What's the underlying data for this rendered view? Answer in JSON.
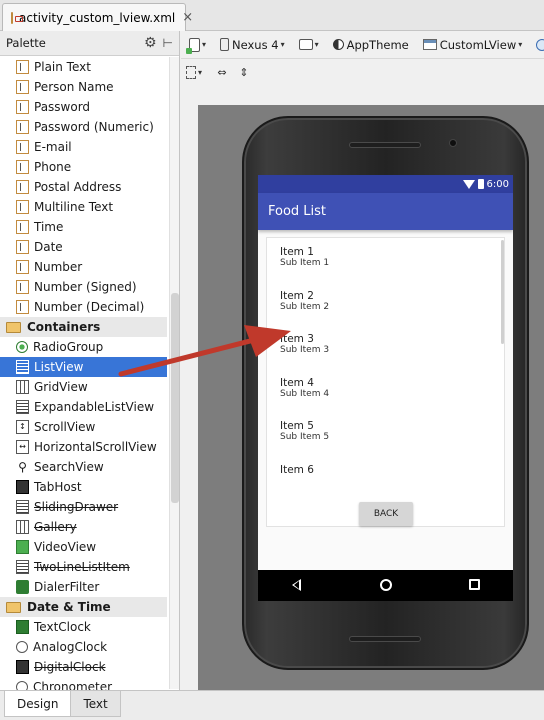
{
  "editor_tab": {
    "title": "activity_custom_lview.xml",
    "close": "×"
  },
  "palette": {
    "title": "Palette",
    "rows": [
      {
        "type": "item",
        "label": "Plain Text",
        "icon": "text-field-icon"
      },
      {
        "type": "item",
        "label": "Person Name",
        "icon": "text-field-icon"
      },
      {
        "type": "item",
        "label": "Password",
        "icon": "text-field-icon"
      },
      {
        "type": "item",
        "label": "Password (Numeric)",
        "icon": "text-field-icon"
      },
      {
        "type": "item",
        "label": "E-mail",
        "icon": "text-field-icon"
      },
      {
        "type": "item",
        "label": "Phone",
        "icon": "text-field-icon"
      },
      {
        "type": "item",
        "label": "Postal Address",
        "icon": "text-field-icon"
      },
      {
        "type": "item",
        "label": "Multiline Text",
        "icon": "text-field-icon"
      },
      {
        "type": "item",
        "label": "Time",
        "icon": "text-field-icon"
      },
      {
        "type": "item",
        "label": "Date",
        "icon": "text-field-icon"
      },
      {
        "type": "item",
        "label": "Number",
        "icon": "text-field-icon"
      },
      {
        "type": "item",
        "label": "Number (Signed)",
        "icon": "text-field-icon"
      },
      {
        "type": "item",
        "label": "Number (Decimal)",
        "icon": "text-field-icon"
      },
      {
        "type": "category",
        "label": "Containers",
        "icon": "folder-icon"
      },
      {
        "type": "item",
        "label": "RadioGroup",
        "icon": "radio-group-icon"
      },
      {
        "type": "item",
        "label": "ListView",
        "icon": "list-view-icon",
        "selected": true
      },
      {
        "type": "item",
        "label": "GridView",
        "icon": "grid-view-icon"
      },
      {
        "type": "item",
        "label": "ExpandableListView",
        "icon": "expandable-list-icon"
      },
      {
        "type": "item",
        "label": "ScrollView",
        "icon": "scroll-view-icon"
      },
      {
        "type": "item",
        "label": "HorizontalScrollView",
        "icon": "horizontal-scroll-icon"
      },
      {
        "type": "item",
        "label": "SearchView",
        "icon": "search-icon"
      },
      {
        "type": "item",
        "label": "TabHost",
        "icon": "tab-host-icon"
      },
      {
        "type": "item",
        "label": "SlidingDrawer",
        "icon": "sliding-drawer-icon",
        "deprecated": true
      },
      {
        "type": "item",
        "label": "Gallery",
        "icon": "gallery-icon",
        "deprecated": true
      },
      {
        "type": "item",
        "label": "VideoView",
        "icon": "video-view-icon"
      },
      {
        "type": "item",
        "label": "TwoLineListItem",
        "icon": "two-line-list-icon",
        "deprecated": true
      },
      {
        "type": "item",
        "label": "DialerFilter",
        "icon": "dialer-filter-icon"
      },
      {
        "type": "category",
        "label": "Date & Time",
        "icon": "folder-icon"
      },
      {
        "type": "item",
        "label": "TextClock",
        "icon": "text-clock-icon"
      },
      {
        "type": "item",
        "label": "AnalogClock",
        "icon": "analog-clock-icon"
      },
      {
        "type": "item",
        "label": "DigitalClock",
        "icon": "digital-clock-icon",
        "deprecated": true
      },
      {
        "type": "item",
        "label": "Chronometer",
        "icon": "chronometer-icon"
      }
    ]
  },
  "toolbar": {
    "device": "Nexus 4",
    "theme": "AppTheme",
    "activity": "CustomLView",
    "caret": "▾"
  },
  "preview": {
    "status_time": "6:00",
    "app_title": "Food List",
    "list_items": [
      {
        "title": "Item 1",
        "sub": "Sub Item 1"
      },
      {
        "title": "Item 2",
        "sub": "Sub Item 2"
      },
      {
        "title": "Item 3",
        "sub": "Sub Item 3"
      },
      {
        "title": "Item 4",
        "sub": "Sub Item 4"
      },
      {
        "title": "Item 5",
        "sub": "Sub Item 5"
      },
      {
        "title": "Item 6",
        "sub": ""
      }
    ],
    "back_label": "BACK"
  },
  "bottom_tabs": [
    {
      "label": "Design",
      "active": true
    },
    {
      "label": "Text",
      "active": false
    }
  ],
  "colors": {
    "selection": "#3875d7",
    "primary": "#3f51b5",
    "primary_dark": "#303f9f",
    "arrow": "#c0392b"
  }
}
